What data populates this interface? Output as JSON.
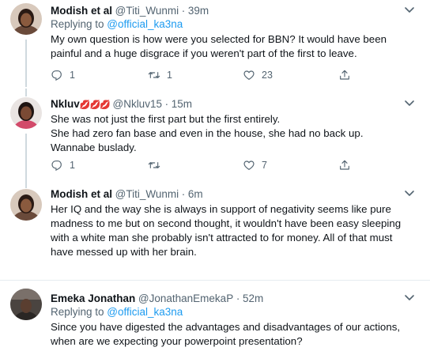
{
  "tweets": [
    {
      "name": "Modish et al",
      "handle": "@Titi_Wunmi",
      "time": "39m",
      "replying_prefix": "Replying to ",
      "replying_to": "@official_ka3na",
      "lines": [
        "My own question is how were you selected for BBN? It would have been",
        "painful and a huge disgrace if you weren't part of the first to leave."
      ],
      "replies": "1",
      "retweets": "1",
      "likes": "23"
    },
    {
      "name": "Nkluv",
      "name_emoji": "💋💋💋",
      "handle": "@Nkluv15",
      "time": "15m",
      "lines": [
        "She was not just the first part but the first entirely.",
        "She had zero fan base and even in the house, she had no back up.",
        "Wannabe buslady."
      ],
      "replies": "1",
      "retweets": "",
      "likes": "7"
    },
    {
      "name": "Modish et al",
      "handle": "@Titi_Wunmi",
      "time": "6m",
      "lines": [
        "Her IQ and the way she is always in support of negativity seems like pure",
        "madness to me but on second thought, it wouldn't have been easy sleeping",
        "with a white man she probably isn't attracted to for money. All of that must",
        "have messed up with her brain."
      ]
    },
    {
      "name": "Emeka Jonathan",
      "handle": "@JonathanEmekaP",
      "time": "52m",
      "replying_prefix": "Replying to ",
      "replying_to": "@official_ka3na",
      "lines": [
        "Since you have digested the advantages and disadvantages of our actions,",
        "when are we expecting your powerpoint presentation?"
      ]
    }
  ],
  "separator": "·",
  "icons": {
    "reply": "reply-icon",
    "retweet": "retweet-icon",
    "like": "heart-icon",
    "share": "share-icon",
    "more": "caret-down-icon"
  },
  "colors": {
    "link": "#1d9bf0",
    "secondary": "#536471",
    "divider": "#e6ecf0"
  }
}
